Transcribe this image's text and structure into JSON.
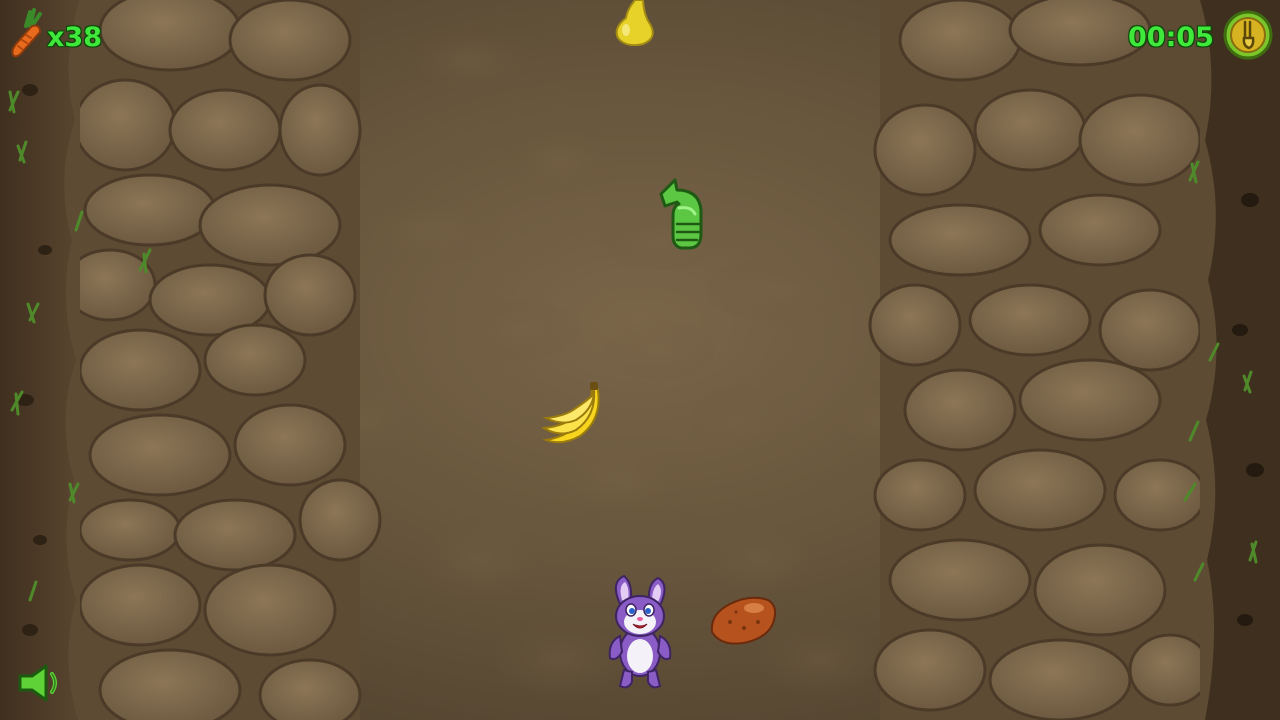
{
  "hud": {
    "carrot_icon": "carrot-icon",
    "carrot_count": "x38",
    "timer": "00:05",
    "hint_button_icon": "hint-hand-icon",
    "sound_button_icon": "speaker-icon"
  },
  "scene": {
    "falling_items": [
      {
        "kind": "pear",
        "icon": "pear-icon"
      },
      {
        "kind": "green-hand",
        "icon": "green-hand-icon"
      },
      {
        "kind": "banana",
        "icon": "banana-icon"
      },
      {
        "kind": "potato",
        "icon": "potato-icon"
      }
    ],
    "player": {
      "kind": "bunny",
      "icon": "purple-bunny-icon"
    }
  },
  "colors": {
    "hud_text": "#3fe83a",
    "hud_text_outline": "#0a4a08",
    "ground": "#6b5940",
    "stone": "#7d6a4f"
  }
}
